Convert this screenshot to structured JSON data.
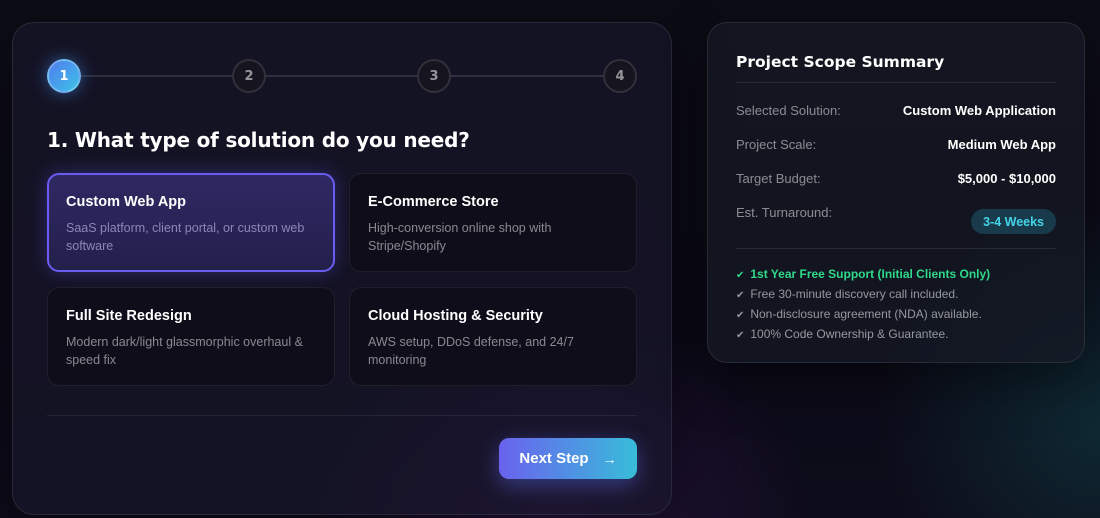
{
  "wizard": {
    "steps": [
      {
        "number": "1",
        "state": "active"
      },
      {
        "number": "2",
        "state": "inactive"
      },
      {
        "number": "3",
        "state": "inactive"
      },
      {
        "number": "4",
        "state": "inactive"
      }
    ],
    "question": "1. What type of solution do you need?",
    "options": [
      {
        "title": "Custom Web App",
        "description": "SaaS platform, client portal, or custom web software",
        "selected": true
      },
      {
        "title": "E-Commerce Store",
        "description": "High-conversion online shop with Stripe/Shopify",
        "selected": false
      },
      {
        "title": "Full Site Redesign",
        "description": "Modern dark/light glassmorphic overhaul & speed fix",
        "selected": false
      },
      {
        "title": "Cloud Hosting & Security",
        "description": "AWS setup, DDoS defense, and 24/7 monitoring",
        "selected": false
      }
    ],
    "next_button": {
      "label": "Next Step",
      "icon": "arrow-right-icon"
    }
  },
  "summary": {
    "title": "Project Scope Summary",
    "rows": [
      {
        "label": "Selected Solution:",
        "value": "Custom Web Application"
      },
      {
        "label": "Project Scale:",
        "value": "Medium Web App"
      },
      {
        "label": "Target Budget:",
        "value": "$5,000 - $10,000"
      },
      {
        "label": "Est. Turnaround:",
        "value": "3-4 Weeks"
      }
    ],
    "benefits": [
      {
        "text": "1st Year Free Support (Initial Clients Only)",
        "highlight": true
      },
      {
        "text": "Free 30-minute discovery call included.",
        "highlight": false
      },
      {
        "text": "Non-disclosure agreement (NDA) available.",
        "highlight": false
      },
      {
        "text": "100% Code Ownership & Guarantee.",
        "highlight": false
      }
    ],
    "check_glyph": "✔"
  },
  "colors": {
    "accent_purple": "#6a5cf0",
    "accent_cyan": "#38bcd9",
    "benefit_green": "#2fd98a",
    "badge_cyan": "#44d4ea"
  }
}
